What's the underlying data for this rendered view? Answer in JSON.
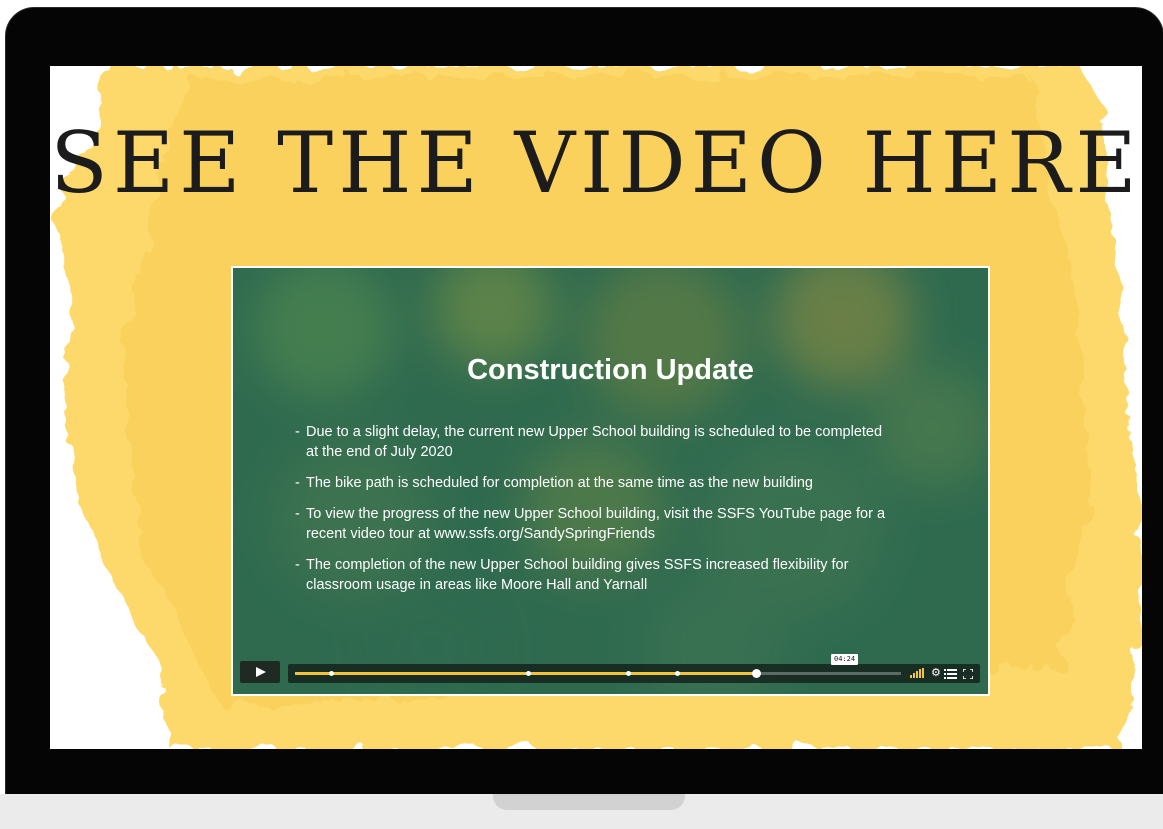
{
  "page": {
    "headline": "SEE THE VIDEO HERE"
  },
  "video": {
    "slide_title": "Construction Update",
    "bullets": [
      {
        "dash": "-",
        "line1": "Due to a slight delay, the current new Upper School building is scheduled to be completed",
        "line2": "at the end of July 2020"
      },
      {
        "dash": "-",
        "line1": "The bike path is scheduled for completion at the same time as the new building",
        "line2": ""
      },
      {
        "dash": "-",
        "line1": "To view the progress of the new Upper School building, visit the SSFS YouTube page for a",
        "line2": "recent video tour at www.ssfs.org/SandySpringFriends"
      },
      {
        "dash": "-",
        "line1": "The completion of the new Upper School building gives SSFS increased flexibility for",
        "line2": "classroom usage in areas like Moore Hall and Yarnall"
      }
    ],
    "player": {
      "time_label": "04:24",
      "progress_fraction": 0.76,
      "chapter_marks": [
        0.06,
        0.385,
        0.55,
        0.63
      ],
      "accent_color": "#f3c33a",
      "controls": [
        "play-icon",
        "volume-icon",
        "gear-icon",
        "list-icon",
        "fullscreen-icon"
      ]
    }
  },
  "colors": {
    "paint": "#fdd96c",
    "slide_bg": "#2f6a4f",
    "frame": "#050505"
  }
}
